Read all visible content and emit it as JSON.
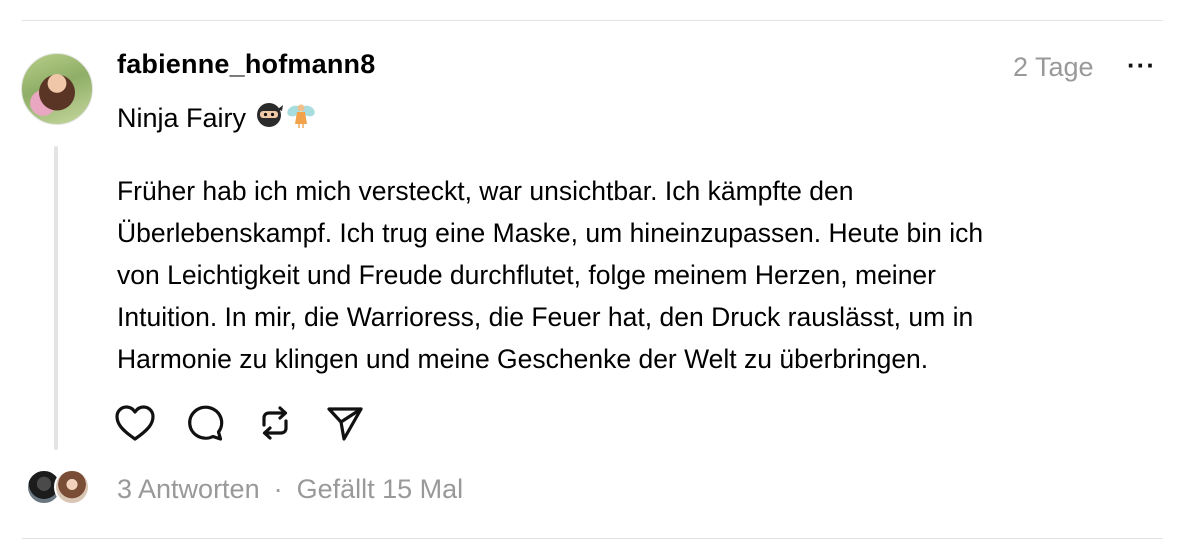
{
  "post": {
    "username": "fabienne_hofmann8",
    "time": "2 Tage",
    "more_label": "···",
    "subtitle": "Ninja Fairy",
    "subtitle_emojis": [
      "ninja-emoji",
      "fairy-emoji"
    ],
    "body": "Früher hab ich mich versteckt, war unsichtbar. Ich kämpfte den\nÜberlebenskampf. Ich trug eine Maske, um hineinzupassen. Heute bin ich\nvon Leichtigkeit und Freude durchflutet, folge meinem Herzen, meiner\nIntuition. In mir, die Warrioress, die Feuer hat, den Druck rauslässt, um in\nHarmonie zu klingen und meine Geschenke der Welt zu überbringen.",
    "actions": [
      "heart-icon",
      "comment-icon",
      "repost-icon",
      "share-icon"
    ]
  },
  "footer": {
    "replies": "3 Antworten",
    "separator": "·",
    "likes": "Gefällt 15 Mal"
  }
}
